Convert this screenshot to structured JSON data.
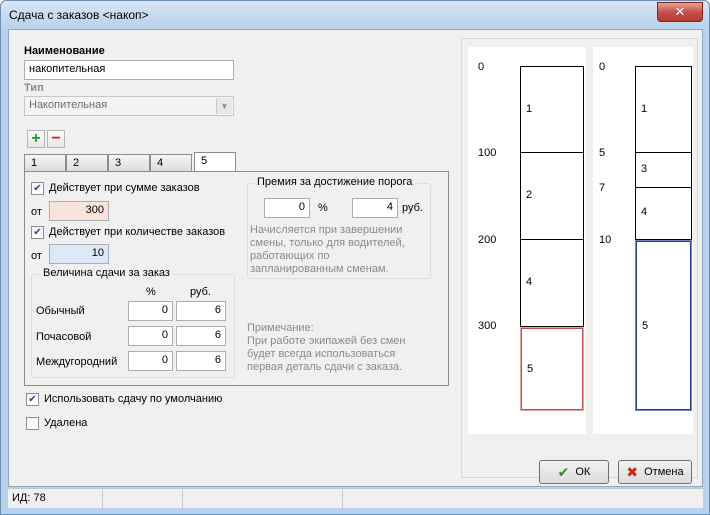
{
  "window": {
    "title": "Сдача с заказов <накоп>",
    "close_glyph": "✕"
  },
  "form": {
    "name_label": "Наименование",
    "name_value": "накопительная",
    "type_label": "Тип",
    "type_value": "Накопительная",
    "add_icon": "plus-icon",
    "remove_icon": "minus-icon"
  },
  "tabs": [
    {
      "label": "1"
    },
    {
      "label": "2"
    },
    {
      "label": "3"
    },
    {
      "label": "4"
    },
    {
      "label": "5"
    }
  ],
  "active_tab": "5",
  "tab5": {
    "sum_check_label": "Действует при сумме заказов",
    "sum_checked": true,
    "from_label": "от",
    "sum_value": "300",
    "count_check_label": "Действует при количестве заказов",
    "count_checked": true,
    "count_from_label": "от",
    "count_value": "10",
    "rates_group_title": "Величина сдачи за заказ",
    "col_percent": "%",
    "col_rub": "руб.",
    "rows": [
      {
        "label": "Обычный",
        "percent": "0",
        "rub": "6"
      },
      {
        "label": "Почасовой",
        "percent": "0",
        "rub": "6"
      },
      {
        "label": "Междугородний",
        "percent": "0",
        "rub": "6"
      }
    ],
    "bonus_group_title": "Премия за достижение порога",
    "bonus_percent": "0",
    "bonus_percent_unit": "%",
    "bonus_rub": "4",
    "bonus_rub_unit": "руб.",
    "bonus_note": "Начисляется при завершении смены, только для водителей, работающих по запланированным сменам.",
    "note_title": "Примечание:",
    "note_text": "При работе экипажей без смен будет всегда использоваться первая деталь сдачи с заказа."
  },
  "use_default_label": "Использовать сдачу по умолчанию",
  "use_default_checked": true,
  "deleted_label": "Удалена",
  "deleted_checked": false,
  "diagram": {
    "sum_scale": [
      "0",
      "100",
      "200",
      "300"
    ],
    "sum_segments": [
      "1",
      "2",
      "4",
      "5"
    ],
    "count_scale": [
      "0",
      "5",
      "7",
      "10"
    ],
    "count_segments": [
      "1",
      "3",
      "4",
      "5"
    ],
    "colors": {
      "highlight_sum": "#c0504d",
      "highlight_count": "#2a3a8a"
    }
  },
  "buttons": {
    "ok": "ОК",
    "cancel": "Отмена",
    "ok_glyph": "✔",
    "cancel_glyph": "✖"
  },
  "status": {
    "id_text": "ИД: 78"
  }
}
